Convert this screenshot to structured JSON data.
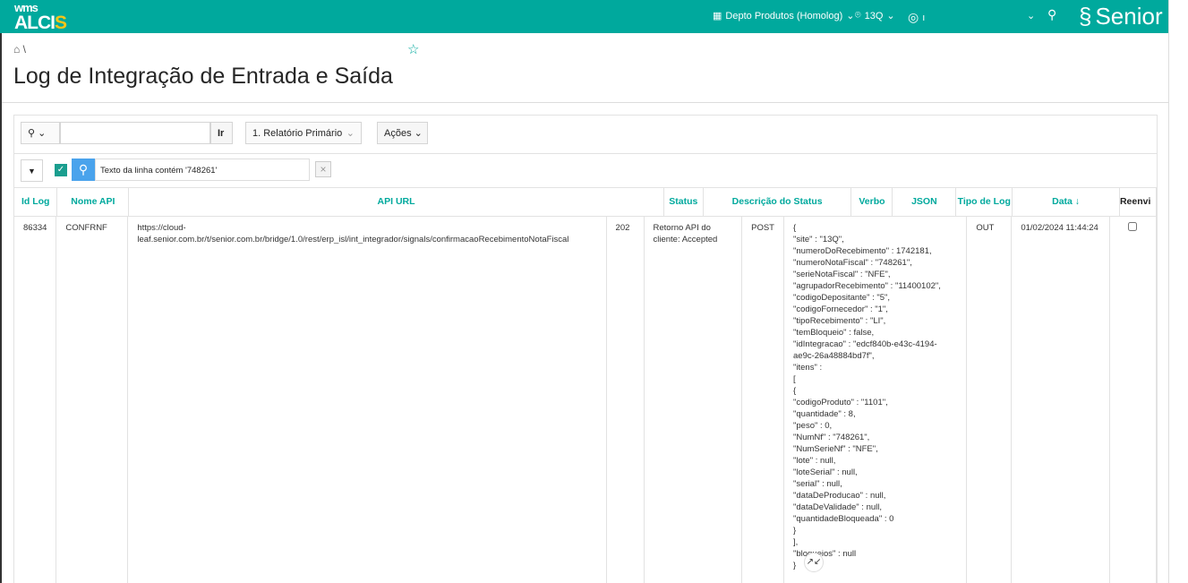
{
  "header": {
    "logo_top": "wms",
    "logo_main": "ALCI",
    "logo_accent": "S",
    "warehouse": "Depto Produtos (Homolog)",
    "site": "13Q",
    "user": "ı",
    "brand": "Senior"
  },
  "breadcrumb": {
    "sep": "\\"
  },
  "page_title": "Log de Integração de Entrada e Saída",
  "toolbar": {
    "search_value": "",
    "go_label": "Ir",
    "report_label": "1. Relatório Primário",
    "actions_label": "Ações"
  },
  "filter": {
    "text": "Texto da linha contém '748261'"
  },
  "columns": [
    "Id Log",
    "Nome API",
    "API URL",
    "Status",
    "Descrição do Status",
    "Verbo",
    "JSON",
    "Tipo de Log",
    "Data ↓",
    "Reenvi"
  ],
  "rows": [
    {
      "id": "86334",
      "api": "CONFRNF",
      "url": "https://cloud-leaf.senior.com.br/t/senior.com.br/bridge/1.0/rest/erp_isl/int_integrador/signals/confirmacaoRecebimentoNotaFiscal",
      "status": "202",
      "desc": "Retorno API do cliente: Accepted",
      "verb": "POST",
      "json": "{\n\"site\" : \"13Q\",\n\"numeroDoRecebimento\" : 1742181,\n\"numeroNotaFiscal\" : \"748261\",\n\"serieNotaFiscal\" : \"NFE\",\n\"agrupadorRecebimento\" : \"11400102\",\n\"codigoDepositante\" : \"5\",\n\"codigoFornecedor\" : \"1\",\n\"tipoRecebimento\" : \"LI\",\n\"temBloqueio\" : false,\n\"idIntegracao\" : \"edcf840b-e43c-4194-ae9c-26a48884bd7f\",\n\"itens\" :\n[\n{\n\"codigoProduto\" : \"1101\",\n\"quantidade\" : 8,\n\"peso\" : 0,\n\"NumNf\" : \"748261\",\n\"NumSerieNf\" : \"NFE\",\n\"lote\" : null,\n\"loteSerial\" : null,\n\"serial\" : null,\n\"dataDeProducao\" : null,\n\"dataDeValidade\" : null,\n\"quantidadeBloqueada\" : 0\n}\n],\n\"bloqueios\" : null\n}",
      "type": "OUT",
      "date": "01/02/2024 11:44:24"
    }
  ]
}
